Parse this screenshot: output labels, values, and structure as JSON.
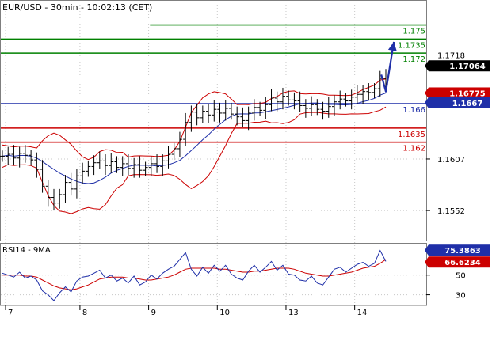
{
  "header": {
    "title": "EUR/USD - 30min - 10:02:13 (CET)"
  },
  "chart_data": [
    {
      "type": "candlestick",
      "title": "EUR/USD - 30min - 10:02:13 (CET)",
      "ylim": [
        1.152,
        1.1775
      ],
      "price_ticks": [
        "1.1718",
        "1.1607",
        "1.1552"
      ],
      "current_price": {
        "label": "1.17064",
        "value": 1.17064,
        "color": "#000000"
      },
      "price_badges": [
        {
          "label": "1.16775",
          "value": 1.16775,
          "color": "#cc0000"
        },
        {
          "label": "1.1667",
          "value": 1.1667,
          "color": "#1f2fa8"
        }
      ],
      "hlines": [
        {
          "label": "1.175",
          "value": 1.175,
          "color": "#008000",
          "start_frac": 0.35
        },
        {
          "label": "1.1735",
          "value": 1.1735,
          "color": "#008000",
          "start_frac": 0.0
        },
        {
          "label": "1.172",
          "value": 1.172,
          "color": "#008000",
          "start_frac": 0.0
        },
        {
          "label": "1.166",
          "value": 1.1666,
          "color": "#1f2fa8",
          "start_frac": 0.0
        },
        {
          "label": "1.1635",
          "value": 1.164,
          "color": "#cc0000",
          "start_frac": 0.0
        },
        {
          "label": "1.162",
          "value": 1.1625,
          "color": "#cc0000",
          "start_frac": 0.0
        }
      ],
      "price_path": [
        1.161,
        1.1612,
        1.1608,
        1.1613,
        1.1611,
        1.1606,
        1.1596,
        1.1578,
        1.1566,
        1.156,
        1.1569,
        1.1582,
        1.1575,
        1.1589,
        1.1594,
        1.1599,
        1.1603,
        1.1605,
        1.16,
        1.1604,
        1.1598,
        1.1602,
        1.1597,
        1.1601,
        1.1595,
        1.1598,
        1.1602,
        1.1599,
        1.1605,
        1.1612,
        1.1618,
        1.1628,
        1.1646,
        1.1657,
        1.1651,
        1.1658,
        1.1654,
        1.166,
        1.1656,
        1.1661,
        1.1655,
        1.1652,
        1.1648,
        1.1656,
        1.1662,
        1.1659,
        1.1665,
        1.1672,
        1.1668,
        1.1674,
        1.167,
        1.1669,
        1.1664,
        1.1661,
        1.1665,
        1.166,
        1.1658,
        1.1663,
        1.1668,
        1.1671,
        1.1669,
        1.1673,
        1.1676,
        1.1679,
        1.1678,
        1.1682,
        1.1693,
        1.1686
      ],
      "projection": {
        "color": "#1f2fa8",
        "points": [
          {
            "x_index": 66.2,
            "y": 1.1697
          },
          {
            "x_index": 67.0,
            "y": 1.1679
          },
          {
            "x_index": 68.4,
            "y": 1.1732
          }
        ]
      },
      "bollinger_color": "#cc0000",
      "ma_color": "#1f2fa8",
      "grid": true
    },
    {
      "type": "line",
      "title": "RSI14 - 9MA",
      "ylim": [
        20,
        82
      ],
      "y_ticks": [
        "50",
        "30"
      ],
      "tick_values": [
        50,
        30
      ],
      "series": [
        {
          "name": "RSI14",
          "label": "75.3863",
          "value": 75.3863,
          "color": "#1f2fa8",
          "values": [
            52,
            50,
            48,
            53,
            47,
            49,
            45,
            34,
            30,
            24,
            32,
            38,
            33,
            44,
            48,
            49,
            52,
            55,
            47,
            50,
            44,
            47,
            42,
            49,
            40,
            43,
            50,
            46,
            52,
            56,
            59,
            66,
            73,
            56,
            49,
            58,
            52,
            60,
            54,
            60,
            51,
            47,
            45,
            54,
            60,
            53,
            58,
            64,
            55,
            60,
            51,
            50,
            45,
            44,
            49,
            42,
            40,
            48,
            56,
            58,
            53,
            57,
            61,
            63,
            59,
            62,
            75,
            64
          ]
        },
        {
          "name": "9MA",
          "label": "66.6234",
          "value": 66.6234,
          "color": "#cc0000",
          "values": [
            50,
            50,
            50,
            50,
            49,
            49,
            48,
            45,
            42,
            39,
            37,
            36,
            35,
            36,
            38,
            40,
            43,
            46,
            47,
            48,
            48,
            48,
            47,
            47,
            46,
            45,
            45,
            46,
            47,
            48,
            50,
            53,
            56,
            57,
            57,
            57,
            57,
            57,
            56,
            56,
            55,
            54,
            53,
            53,
            54,
            54,
            55,
            56,
            57,
            57,
            57,
            56,
            54,
            52,
            51,
            50,
            49,
            49,
            50,
            51,
            52,
            53,
            55,
            57,
            58,
            59,
            62,
            66
          ]
        }
      ],
      "grid": true
    }
  ],
  "x_axis": {
    "days": [
      {
        "label": "7",
        "index": 0
      },
      {
        "label": "8",
        "index": 13
      },
      {
        "label": "9",
        "index": 25
      },
      {
        "label": "10",
        "index": 37
      },
      {
        "label": "13",
        "index": 49
      },
      {
        "label": "14",
        "index": 61
      }
    ]
  }
}
